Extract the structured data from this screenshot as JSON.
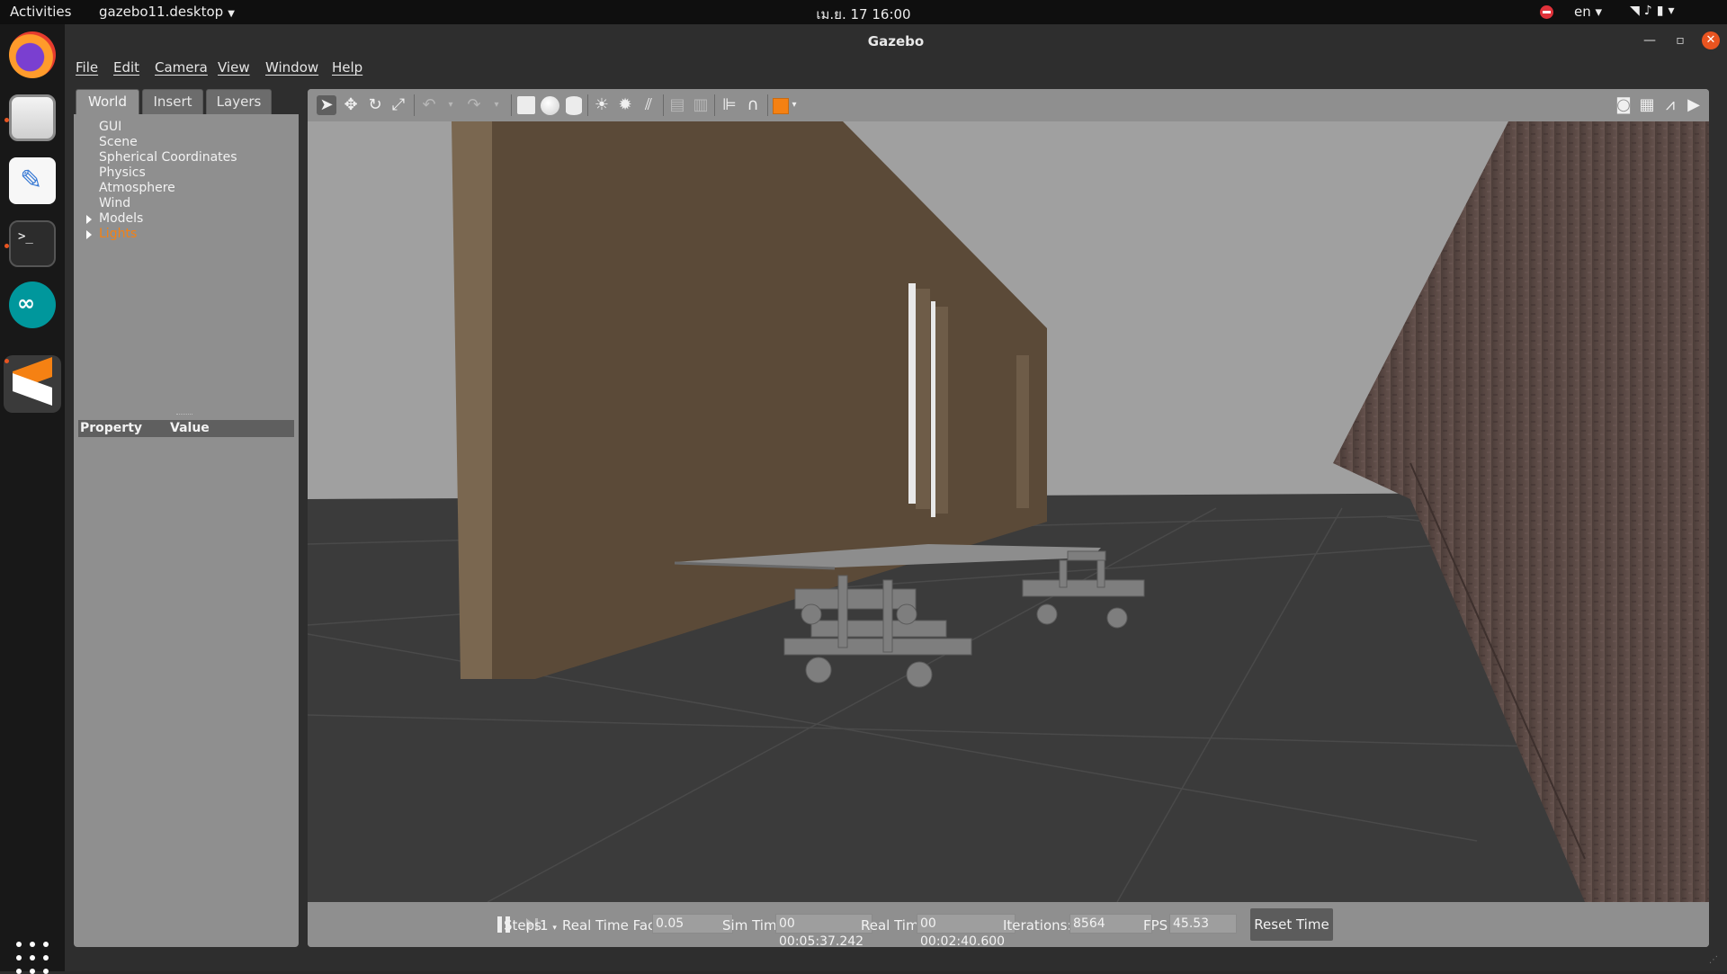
{
  "topbar": {
    "activities": "Activities",
    "app_menu": "gazebo11.desktop",
    "clock": "เม.ย. 17  16:00",
    "lang": "en"
  },
  "window": {
    "title": "Gazebo"
  },
  "menu": {
    "items": [
      "File",
      "Edit",
      "Camera",
      "View",
      "Window",
      "Help"
    ]
  },
  "left_panel": {
    "tabs": [
      "World",
      "Insert",
      "Layers"
    ],
    "selected_tab": "World",
    "tree": [
      {
        "label": "GUI",
        "expandable": false
      },
      {
        "label": "Scene",
        "expandable": false
      },
      {
        "label": "Spherical Coordinates",
        "expandable": false
      },
      {
        "label": "Physics",
        "expandable": false
      },
      {
        "label": "Atmosphere",
        "expandable": false
      },
      {
        "label": "Wind",
        "expandable": false
      },
      {
        "label": "Models",
        "expandable": true
      },
      {
        "label": "Lights",
        "expandable": true,
        "highlighted": true
      }
    ],
    "property_header": {
      "property": "Property",
      "value": "Value"
    }
  },
  "toolbar": {
    "tools": [
      "select-arrow-icon",
      "translate-icon",
      "rotate-icon",
      "scale-icon",
      "undo-icon",
      "redo-icon",
      "box-icon",
      "sphere-icon",
      "cylinder-icon",
      "point-light-icon",
      "spot-light-icon",
      "directional-light-icon",
      "copy-icon",
      "paste-icon",
      "align-icon",
      "magnet-icon",
      "view-angle-icon",
      "screenshot-icon",
      "log-icon",
      "plot-icon",
      "record-video-icon"
    ]
  },
  "bottom_bar": {
    "steps_label": "Steps:",
    "steps_value": "1",
    "rtf_label": "Real Time Factor:",
    "rtf_value": "0.05",
    "sim_time_label": "Sim Time:",
    "sim_time_value": "00 00:05:37.242",
    "real_time_label": "Real Time:",
    "real_time_value": "00 00:02:40.600",
    "iterations_label": "Iterations:",
    "iterations_value": "8564",
    "fps_label": "FPS:",
    "fps_value": "45.53",
    "reset_button": "Reset Time"
  },
  "colors": {
    "accent": "#f58113",
    "panel": "#8f8f8f",
    "sky": "#a0a0a0",
    "ground": "#3b3b3b",
    "wall_brown": "#5b4a38",
    "brick_wall": "#5a4843"
  }
}
